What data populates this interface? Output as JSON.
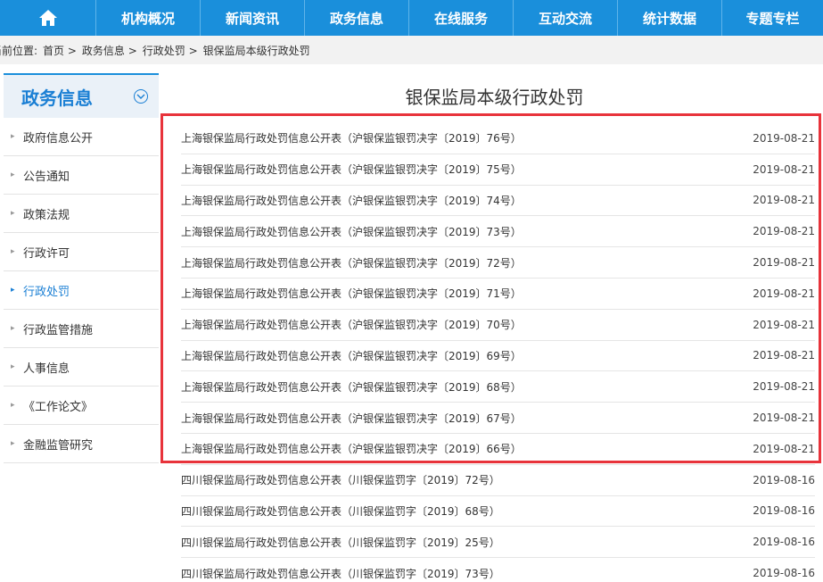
{
  "nav": {
    "items": [
      "机构概况",
      "新闻资讯",
      "政务信息",
      "在线服务",
      "互动交流",
      "统计数据",
      "专题专栏"
    ]
  },
  "breadcrumb": {
    "prefix": "当前位置:",
    "items": [
      "首页 >",
      "政务信息 >",
      "行政处罚 >",
      "银保监局本级行政处罚"
    ]
  },
  "sidebar": {
    "title": "政务信息",
    "items": [
      {
        "label": "政府信息公开"
      },
      {
        "label": "公告通知"
      },
      {
        "label": "政策法规"
      },
      {
        "label": "行政许可"
      },
      {
        "label": "行政处罚"
      },
      {
        "label": "行政监管措施"
      },
      {
        "label": "人事信息"
      },
      {
        "label": "《工作论文》"
      },
      {
        "label": "金融监管研究"
      }
    ]
  },
  "main": {
    "title": "银保监局本级行政处罚",
    "rows": [
      {
        "title": "上海银保监局行政处罚信息公开表（沪银保监银罚决字〔2019〕76号）",
        "date": "2019-08-21"
      },
      {
        "title": "上海银保监局行政处罚信息公开表（沪银保监银罚决字〔2019〕75号）",
        "date": "2019-08-21"
      },
      {
        "title": "上海银保监局行政处罚信息公开表（沪银保监银罚决字〔2019〕74号）",
        "date": "2019-08-21"
      },
      {
        "title": "上海银保监局行政处罚信息公开表（沪银保监银罚决字〔2019〕73号）",
        "date": "2019-08-21"
      },
      {
        "title": "上海银保监局行政处罚信息公开表（沪银保监银罚决字〔2019〕72号）",
        "date": "2019-08-21"
      },
      {
        "title": "上海银保监局行政处罚信息公开表（沪银保监银罚决字〔2019〕71号）",
        "date": "2019-08-21"
      },
      {
        "title": "上海银保监局行政处罚信息公开表（沪银保监银罚决字〔2019〕70号）",
        "date": "2019-08-21"
      },
      {
        "title": "上海银保监局行政处罚信息公开表（沪银保监银罚决字〔2019〕69号）",
        "date": "2019-08-21"
      },
      {
        "title": "上海银保监局行政处罚信息公开表（沪银保监银罚决字〔2019〕68号）",
        "date": "2019-08-21"
      },
      {
        "title": "上海银保监局行政处罚信息公开表（沪银保监银罚决字〔2019〕67号）",
        "date": "2019-08-21"
      },
      {
        "title": "上海银保监局行政处罚信息公开表（沪银保监银罚决字〔2019〕66号）",
        "date": "2019-08-21"
      },
      {
        "title": "四川银保监局行政处罚信息公开表（川银保监罚字〔2019〕72号）",
        "date": "2019-08-16"
      },
      {
        "title": "四川银保监局行政处罚信息公开表（川银保监罚字〔2019〕68号）",
        "date": "2019-08-16"
      },
      {
        "title": "四川银保监局行政处罚信息公开表（川银保监罚字〔2019〕25号）",
        "date": "2019-08-16"
      },
      {
        "title": "四川银保监局行政处罚信息公开表（川银保监罚字〔2019〕73号）",
        "date": "2019-08-16"
      }
    ]
  },
  "colors": {
    "nav_bg": "#1a8fdb",
    "accent": "#1a7fd4",
    "highlight": "#e8333b"
  }
}
